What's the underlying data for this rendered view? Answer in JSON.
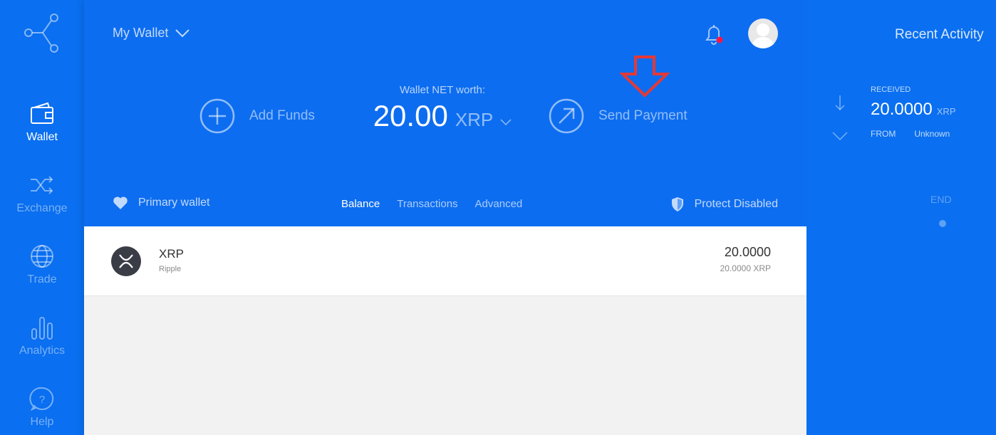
{
  "sidebar": {
    "items": [
      {
        "label": "Wallet",
        "icon": "wallet-icon",
        "active": true
      },
      {
        "label": "Exchange",
        "icon": "shuffle-icon",
        "active": false
      },
      {
        "label": "Trade",
        "icon": "globe-icon",
        "active": false
      },
      {
        "label": "Analytics",
        "icon": "bar-chart-icon",
        "active": false
      },
      {
        "label": "Help",
        "icon": "help-icon",
        "active": false
      }
    ]
  },
  "header": {
    "wallet_select": "My Wallet",
    "net_label": "Wallet NET worth:",
    "net_amount": "20.00",
    "net_currency": "XRP",
    "add_funds": "Add Funds",
    "send_payment": "Send Payment",
    "primary_wallet": "Primary wallet",
    "tabs": [
      "Balance",
      "Transactions",
      "Advanced"
    ],
    "active_tab": "Balance",
    "protect": "Protect Disabled"
  },
  "assets": [
    {
      "name": "XRP",
      "sub": "Ripple",
      "balance": "20.0000",
      "balance_sub": "20.0000 XRP"
    }
  ],
  "recent": {
    "title": "Recent Activity",
    "items": [
      {
        "type": "RECEIVED",
        "amount": "20.0000",
        "currency": "XRP",
        "from_label": "FROM",
        "from": "Unknown"
      }
    ],
    "end": "END"
  },
  "colors": {
    "brand_blue": "#0b6ff0",
    "notification_dot": "#ff1744",
    "annotation_arrow": "#e53935"
  }
}
